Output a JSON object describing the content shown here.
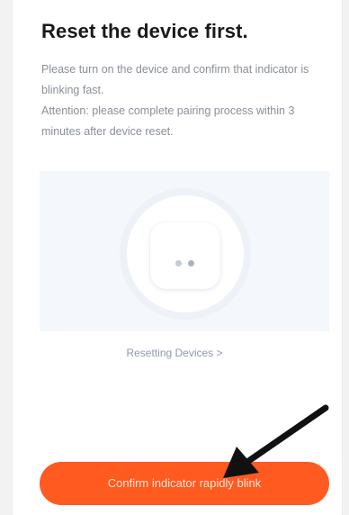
{
  "header": {
    "title": "Reset the device first."
  },
  "instructions": {
    "line1": "Please turn on the device and confirm that indicator is blinking fast.",
    "line2": "Attention: please complete pairing process within 3 minutes after device reset."
  },
  "illustration": {
    "icon": "smart-plug-device"
  },
  "reset_link": {
    "label": "Resetting Devices >"
  },
  "confirm_button": {
    "label": "Confirm indicator rapidly blink",
    "color": "#ff5a1f"
  },
  "annotation": {
    "icon": "arrow-pointer",
    "color": "#111111"
  }
}
